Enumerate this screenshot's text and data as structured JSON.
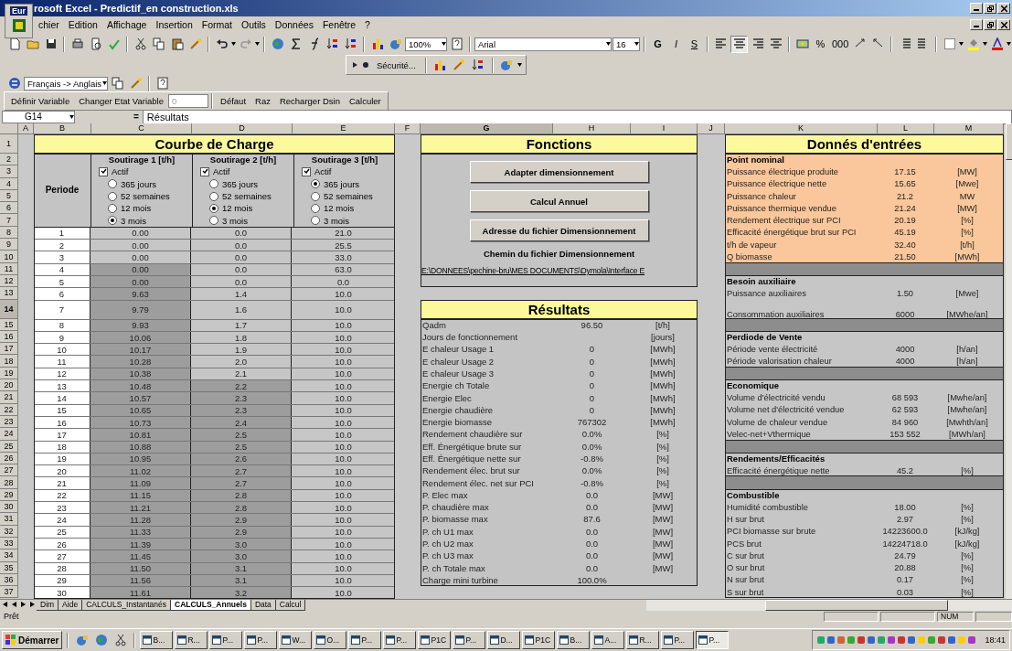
{
  "window": {
    "widget_label": "Eur",
    "title": "rosoft Excel - Predictif_en construction.xls"
  },
  "menu": [
    "chier",
    "Edition",
    "Affichage",
    "Insertion",
    "Format",
    "Outils",
    "Données",
    "Fenêtre",
    "?"
  ],
  "toolbar": {
    "zoom": "100%",
    "font": "Arial",
    "size": "16",
    "percent": "%",
    "thousands": "000",
    "style_buttons": [
      {
        "label": "G",
        "selected": false
      },
      {
        "label": "I",
        "selected": false
      },
      {
        "label": "S",
        "selected": false
      }
    ],
    "align_buttons": [
      {
        "selected": false
      },
      {
        "selected": true
      },
      {
        "selected": false
      },
      {
        "selected": false
      }
    ]
  },
  "security_bar": {
    "label": "Sécurité..."
  },
  "translator": {
    "value": "Français -> Anglais"
  },
  "macro_bar": {
    "buttons": [
      "Définir Variable",
      "Changer Etat Variable"
    ],
    "state_field": {
      "value": "0",
      "disabled": true
    },
    "buttons_2": [
      "Défaut",
      "Raz",
      "Recharger Dsin",
      "Calculer"
    ]
  },
  "formula_bar": {
    "cell": "G14",
    "equals": "=",
    "content": "Résultats"
  },
  "columns": [
    {
      "label": "A",
      "selected": false
    },
    {
      "label": "B",
      "selected": false
    },
    {
      "label": "C",
      "selected": false
    },
    {
      "label": "D",
      "selected": false
    },
    {
      "label": "E",
      "selected": false
    },
    {
      "label": "F",
      "selected": false
    },
    {
      "label": "G",
      "selected": true
    },
    {
      "label": "H",
      "selected": false
    },
    {
      "label": "I",
      "selected": false
    },
    {
      "label": "J",
      "selected": false
    },
    {
      "label": "K",
      "selected": false
    },
    {
      "label": "L",
      "selected": false
    },
    {
      "label": "M",
      "selected": false
    }
  ],
  "row_headers": [
    {
      "label": "1",
      "selected": false
    },
    {
      "label": "2",
      "selected": false
    },
    {
      "label": "3",
      "selected": false
    },
    {
      "label": "4",
      "selected": false
    },
    {
      "label": "5",
      "selected": false
    },
    {
      "label": "6",
      "selected": false
    },
    {
      "label": "7",
      "selected": false
    },
    {
      "label": "8",
      "selected": false
    },
    {
      "label": "9",
      "selected": false
    },
    {
      "label": "10",
      "selected": false
    },
    {
      "label": "11",
      "selected": false
    },
    {
      "label": "12",
      "selected": false
    },
    {
      "label": "13",
      "selected": false
    },
    {
      "label": "14",
      "selected": true
    },
    {
      "label": "15",
      "selected": false
    },
    {
      "label": "16",
      "selected": false
    },
    {
      "label": "17",
      "selected": false
    },
    {
      "label": "18",
      "selected": false
    },
    {
      "label": "19",
      "selected": false
    },
    {
      "label": "20",
      "selected": false
    },
    {
      "label": "21",
      "selected": false
    },
    {
      "label": "22",
      "selected": false
    },
    {
      "label": "23",
      "selected": false
    },
    {
      "label": "24",
      "selected": false
    },
    {
      "label": "25",
      "selected": false
    },
    {
      "label": "26",
      "selected": false
    },
    {
      "label": "27",
      "selected": false
    },
    {
      "label": "28",
      "selected": false
    },
    {
      "label": "29",
      "selected": false
    },
    {
      "label": "30",
      "selected": false
    },
    {
      "label": "31",
      "selected": false
    },
    {
      "label": "32",
      "selected": false
    },
    {
      "label": "33",
      "selected": false
    },
    {
      "label": "34",
      "selected": false
    },
    {
      "label": "35",
      "selected": false
    },
    {
      "label": "36",
      "selected": false
    },
    {
      "label": "37",
      "selected": false
    }
  ],
  "load_curve": {
    "title": "Courbe de Charge",
    "period_header": "Periode",
    "columns": [
      {
        "title": "Soutirage 1 [t/h]",
        "active": {
          "label": "Actif",
          "checked": true
        },
        "options": [
          {
            "label": "365 jours",
            "selected": false
          },
          {
            "label": "52 semaines",
            "selected": false
          },
          {
            "label": "12 mois",
            "selected": false
          },
          {
            "label": "3 mois",
            "selected": true
          }
        ]
      },
      {
        "title": "Soutirage 2 [t/h]",
        "active": {
          "label": "Actif",
          "checked": true
        },
        "options": [
          {
            "label": "365 jours",
            "selected": false
          },
          {
            "label": "52 semaines",
            "selected": false
          },
          {
            "label": "12 mois",
            "selected": true
          },
          {
            "label": "3 mois",
            "selected": false
          }
        ]
      },
      {
        "title": "Soutirage 3 [t/h]",
        "active": {
          "label": "Actif",
          "checked": true
        },
        "options": [
          {
            "label": "365 jours",
            "selected": true
          },
          {
            "label": "52 semaines",
            "selected": false
          },
          {
            "label": "12 mois",
            "selected": false
          },
          {
            "label": "3 mois",
            "selected": false
          }
        ]
      }
    ],
    "rows": [
      {
        "period": "1",
        "values": [
          "0.00",
          "0.0",
          "21.0"
        ],
        "shaded": [
          false,
          false,
          false
        ]
      },
      {
        "period": "2",
        "values": [
          "0.00",
          "0.0",
          "25.5"
        ],
        "shaded": [
          false,
          false,
          false
        ]
      },
      {
        "period": "3",
        "values": [
          "0.00",
          "0.0",
          "33.0"
        ],
        "shaded": [
          false,
          false,
          false
        ]
      },
      {
        "period": "4",
        "values": [
          "0.00",
          "0.0",
          "63.0"
        ],
        "shaded": [
          true,
          false,
          false
        ]
      },
      {
        "period": "5",
        "values": [
          "0.00",
          "0.0",
          "0.0"
        ],
        "shaded": [
          true,
          false,
          false
        ]
      },
      {
        "period": "6",
        "values": [
          "9.63",
          "1.4",
          "10.0"
        ],
        "shaded": [
          true,
          false,
          false
        ]
      },
      {
        "period": "7",
        "values": [
          "9.79",
          "1.6",
          "10.0"
        ],
        "shaded": [
          true,
          false,
          false
        ]
      },
      {
        "period": "8",
        "values": [
          "9.93",
          "1.7",
          "10.0"
        ],
        "shaded": [
          true,
          false,
          false
        ]
      },
      {
        "period": "9",
        "values": [
          "10.06",
          "1.8",
          "10.0"
        ],
        "shaded": [
          true,
          false,
          false
        ]
      },
      {
        "period": "10",
        "values": [
          "10.17",
          "1.9",
          "10.0"
        ],
        "shaded": [
          true,
          false,
          false
        ]
      },
      {
        "period": "11",
        "values": [
          "10.28",
          "2.0",
          "10.0"
        ],
        "shaded": [
          true,
          false,
          false
        ]
      },
      {
        "period": "12",
        "values": [
          "10.38",
          "2.1",
          "10.0"
        ],
        "shaded": [
          true,
          false,
          false
        ]
      },
      {
        "period": "13",
        "values": [
          "10.48",
          "2.2",
          "10.0"
        ],
        "shaded": [
          true,
          true,
          false
        ]
      },
      {
        "period": "14",
        "values": [
          "10.57",
          "2.3",
          "10.0"
        ],
        "shaded": [
          true,
          true,
          false
        ]
      },
      {
        "period": "15",
        "values": [
          "10.65",
          "2.3",
          "10.0"
        ],
        "shaded": [
          true,
          true,
          false
        ]
      },
      {
        "period": "16",
        "values": [
          "10.73",
          "2.4",
          "10.0"
        ],
        "shaded": [
          true,
          true,
          false
        ]
      },
      {
        "period": "17",
        "values": [
          "10.81",
          "2.5",
          "10.0"
        ],
        "shaded": [
          true,
          true,
          false
        ]
      },
      {
        "period": "18",
        "values": [
          "10.88",
          "2.5",
          "10.0"
        ],
        "shaded": [
          true,
          true,
          false
        ]
      },
      {
        "period": "19",
        "values": [
          "10.95",
          "2.6",
          "10.0"
        ],
        "shaded": [
          true,
          true,
          false
        ]
      },
      {
        "period": "20",
        "values": [
          "11.02",
          "2.7",
          "10.0"
        ],
        "shaded": [
          true,
          true,
          false
        ]
      },
      {
        "period": "21",
        "values": [
          "11.09",
          "2.7",
          "10.0"
        ],
        "shaded": [
          true,
          true,
          false
        ]
      },
      {
        "period": "22",
        "values": [
          "11.15",
          "2.8",
          "10.0"
        ],
        "shaded": [
          true,
          true,
          false
        ]
      },
      {
        "period": "23",
        "values": [
          "11.21",
          "2.8",
          "10.0"
        ],
        "shaded": [
          true,
          true,
          false
        ]
      },
      {
        "period": "24",
        "values": [
          "11.28",
          "2.9",
          "10.0"
        ],
        "shaded": [
          true,
          true,
          false
        ]
      },
      {
        "period": "25",
        "values": [
          "11.33",
          "2.9",
          "10.0"
        ],
        "shaded": [
          true,
          true,
          false
        ]
      },
      {
        "period": "26",
        "values": [
          "11.39",
          "3.0",
          "10.0"
        ],
        "shaded": [
          true,
          true,
          false
        ]
      },
      {
        "period": "27",
        "values": [
          "11.45",
          "3.0",
          "10.0"
        ],
        "shaded": [
          true,
          true,
          false
        ]
      },
      {
        "period": "28",
        "values": [
          "11.50",
          "3.1",
          "10.0"
        ],
        "shaded": [
          true,
          true,
          false
        ]
      },
      {
        "period": "29",
        "values": [
          "11.56",
          "3.1",
          "10.0"
        ],
        "shaded": [
          true,
          true,
          false
        ]
      },
      {
        "period": "30",
        "values": [
          "11.61",
          "3.2",
          "10.0"
        ],
        "shaded": [
          true,
          true,
          false
        ]
      }
    ]
  },
  "functions": {
    "title": "Fonctions",
    "buttons": [
      "Adapter dimensionnement",
      "Calcul Annuel",
      "Adresse du fichier Dimensionnement"
    ],
    "path_label": "Chemin du fichier Dimensionnement",
    "path": "E:\\DONNEES\\pechine-bru\\MES DOCUMENTS\\Dymola\\Interface E"
  },
  "results": {
    "title": "Résultats",
    "rows": [
      {
        "label": "Qadm",
        "value": "96.50",
        "unit": "[t/h]"
      },
      {
        "label": "Jours de fonctionnement",
        "unit": "[jours]"
      },
      {
        "label": "E chaleur Usage 1",
        "value": "0",
        "unit": "[MWh]"
      },
      {
        "label": "E chaleur Usage 2",
        "value": "0",
        "unit": "[MWh]"
      },
      {
        "label": "E chaleur Usage 3",
        "value": "0",
        "unit": "[MWh]"
      },
      {
        "label": "Energie ch Totale",
        "value": "0",
        "unit": "[MWh]"
      },
      {
        "label": "Energie Elec",
        "value": "0",
        "unit": "[MWh]"
      },
      {
        "label": "Energie chaudière",
        "value": "0",
        "unit": "[MWh]"
      },
      {
        "label": "Energie biomasse",
        "value": "767302",
        "unit": "[MWh]"
      },
      {
        "label": "Rendement chaudière sur",
        "value": "0.0%",
        "unit": "[%]"
      },
      {
        "label": "Eff. Énergétique brute sur",
        "value": "0.0%",
        "unit": "[%]"
      },
      {
        "label": "Eff. Énergétique nette sur",
        "value": "-0.8%",
        "unit": "[%]"
      },
      {
        "label": "Rendement élec. brut sur",
        "value": "0.0%",
        "unit": "[%]"
      },
      {
        "label": "Rendement élec. net sur PCI",
        "value": "-0.8%",
        "unit": "[%]"
      },
      {
        "label": "P. Elec max",
        "value": "0.0",
        "unit": "[MW]"
      },
      {
        "label": "P. chaudière max",
        "value": "0.0",
        "unit": "[MW]"
      },
      {
        "label": "P. biomasse max",
        "value": "87.6",
        "unit": "[MW]"
      },
      {
        "label": "P. ch U1 max",
        "value": "0.0",
        "unit": "[MW]"
      },
      {
        "label": "P. ch U2 max",
        "value": "0.0",
        "unit": "[MW]"
      },
      {
        "label": "P. ch U3 max",
        "value": "0.0",
        "unit": "[MW]"
      },
      {
        "label": "P. ch Totale max",
        "value": "0.0",
        "unit": "[MW]"
      },
      {
        "label": "Charge mini turbine",
        "value": "100.0%"
      }
    ]
  },
  "inputs": {
    "title": "Donnés d'entrées",
    "sections": [
      {
        "title": "Point nominal",
        "color": "#f9c79b",
        "rows": [
          {
            "label": "Puissance électrique produite",
            "value": "17.15",
            "unit": "[MW]"
          },
          {
            "label": "Puissance électrique nette",
            "value": "15.65",
            "unit": "[Mwe]"
          },
          {
            "label": "Puissance chaleur",
            "value": "21.2",
            "unit": "MW"
          },
          {
            "label": "Puissance thermique vendue",
            "value": "21.24",
            "unit": "[MW]"
          },
          {
            "label": "Rendement électrique sur PCI",
            "value": "20.19",
            "unit": "[%]"
          },
          {
            "label": "Efficacité énergétique brut sur PCI",
            "value": "45.19",
            "unit": "[%]"
          },
          {
            "label": "t/h de vapeur",
            "value": "32.40",
            "unit": "[t/h]"
          },
          {
            "label": "Q biomasse",
            "value": "21.50",
            "unit": "[MWh]"
          }
        ]
      },
      {
        "title": "Besoin auxiliaire",
        "color": "#c6c6c6",
        "rows": [
          {
            "label": "Puissance auxiliaires",
            "value": "1.50",
            "unit": "[Mwe]"
          },
          {
            "label": "Consommation auxiliaires",
            "value": "6000",
            "unit": "[MWhe/an]"
          }
        ]
      },
      {
        "title": "Perdiode de Vente",
        "color": "#c6c6c6",
        "rows": [
          {
            "label": "Période vente électricité",
            "value": "4000",
            "unit": "[h/an]"
          },
          {
            "label": "Période valorisation chaleur",
            "value": "4000",
            "unit": "[h/an]"
          }
        ]
      },
      {
        "title": "Economique",
        "color": "#c6c6c6",
        "rows": [
          {
            "label": "Volume d'électricité vendu",
            "value": "68 593",
            "unit": "[Mwhe/an]"
          },
          {
            "label": "Volume net d'électricité vendue",
            "value": "62 593",
            "unit": "[Mwhe/an]"
          },
          {
            "label": "Volume de chaleur vendue",
            "value": "84 960",
            "unit": "[Mwhth/an]"
          },
          {
            "label": "Velec-net+Vthermique",
            "value": "153 552",
            "unit": "[MWh/an]"
          }
        ]
      },
      {
        "title": "Rendements/Efficacités",
        "color": "#c6c6c6",
        "rows": [
          {
            "label": "Efficacité énergétique nette",
            "value": "45.2",
            "unit": "[%]"
          }
        ]
      },
      {
        "title": "Combustible",
        "color": "#c6c6c6",
        "rows": [
          {
            "label": "Humidité combustible",
            "value": "18.00",
            "unit": "[%]"
          },
          {
            "label": "H sur brut",
            "value": "2.97",
            "unit": "[%]"
          },
          {
            "label": "PCI biomasse sur brute",
            "value": "14223600.0",
            "unit": "[kJ/kg]"
          },
          {
            "label": "PCS brut",
            "value": "14224718.0",
            "unit": "[kJ/kg]"
          },
          {
            "label": "C sur brut",
            "value": "24.79",
            "unit": "[%]"
          },
          {
            "label": "O sur brut",
            "value": "20.88",
            "unit": "[%]"
          },
          {
            "label": "N sur brut",
            "value": "0.17",
            "unit": "[%]"
          },
          {
            "label": "S sur brut",
            "value": "0.03",
            "unit": "[%]"
          }
        ]
      }
    ]
  },
  "sheet_tabs": [
    {
      "label": "Dim",
      "selected": false
    },
    {
      "label": "Aide",
      "selected": false
    },
    {
      "label": "CALCULS_Instantanés",
      "selected": false
    },
    {
      "label": "CALCULS_Annuels",
      "selected": true
    },
    {
      "label": "Data",
      "selected": false
    },
    {
      "label": "Calcul",
      "selected": false
    }
  ],
  "status_bar": {
    "status": "Prêt",
    "num": "NUM"
  },
  "taskbar": {
    "start": "Démarrer",
    "items": [
      {
        "label": "B...",
        "selected": false
      },
      {
        "label": "R...",
        "selected": false
      },
      {
        "label": "P...",
        "selected": false
      },
      {
        "label": "P...",
        "selected": false
      },
      {
        "label": "W...",
        "selected": false
      },
      {
        "label": "O...",
        "selected": false
      },
      {
        "label": "P...",
        "selected": false
      },
      {
        "label": "P...",
        "selected": false
      },
      {
        "label": "P1C",
        "selected": false
      },
      {
        "label": "P...",
        "selected": false
      },
      {
        "label": "D...",
        "selected": false
      },
      {
        "label": "P1C",
        "selected": false
      },
      {
        "label": "B...",
        "selected": false
      },
      {
        "label": "A...",
        "selected": false
      },
      {
        "label": "R...",
        "selected": false
      },
      {
        "label": "P...",
        "selected": false
      },
      {
        "label": "P...",
        "selected": true
      }
    ],
    "clock": "18:41"
  }
}
